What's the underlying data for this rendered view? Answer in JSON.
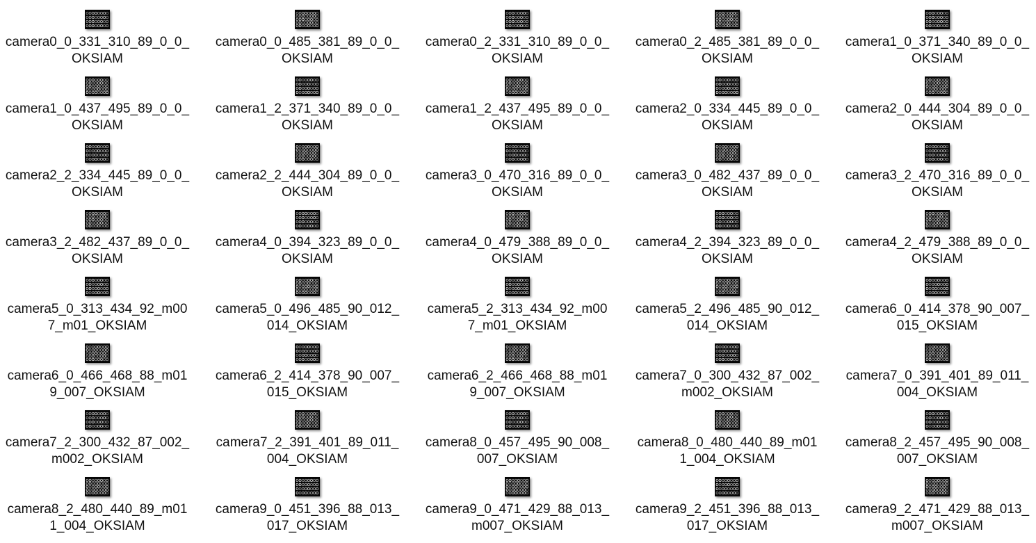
{
  "files": [
    {
      "line1": "camera0_0_331_310_89_0_0_",
      "line2": "OKSIAM",
      "thumbnail_icon": "image-thumbnail-icon"
    },
    {
      "line1": "camera0_0_485_381_89_0_0_",
      "line2": "OKSIAM",
      "thumbnail_icon": "image-thumbnail-icon"
    },
    {
      "line1": "camera0_2_331_310_89_0_0_",
      "line2": "OKSIAM",
      "thumbnail_icon": "image-thumbnail-icon"
    },
    {
      "line1": "camera0_2_485_381_89_0_0_",
      "line2": "OKSIAM",
      "thumbnail_icon": "image-thumbnail-icon"
    },
    {
      "line1": "camera1_0_371_340_89_0_0_",
      "line2": "OKSIAM",
      "thumbnail_icon": "image-thumbnail-icon"
    },
    {
      "line1": "camera1_0_437_495_89_0_0_",
      "line2": "OKSIAM",
      "thumbnail_icon": "image-thumbnail-icon"
    },
    {
      "line1": "camera1_2_371_340_89_0_0_",
      "line2": "OKSIAM",
      "thumbnail_icon": "image-thumbnail-icon"
    },
    {
      "line1": "camera1_2_437_495_89_0_0_",
      "line2": "OKSIAM",
      "thumbnail_icon": "image-thumbnail-icon"
    },
    {
      "line1": "camera2_0_334_445_89_0_0_",
      "line2": "OKSIAM",
      "thumbnail_icon": "image-thumbnail-icon"
    },
    {
      "line1": "camera2_0_444_304_89_0_0_",
      "line2": "OKSIAM",
      "thumbnail_icon": "image-thumbnail-icon"
    },
    {
      "line1": "camera2_2_334_445_89_0_0_",
      "line2": "OKSIAM",
      "thumbnail_icon": "image-thumbnail-icon"
    },
    {
      "line1": "camera2_2_444_304_89_0_0_",
      "line2": "OKSIAM",
      "thumbnail_icon": "image-thumbnail-icon"
    },
    {
      "line1": "camera3_0_470_316_89_0_0_",
      "line2": "OKSIAM",
      "thumbnail_icon": "image-thumbnail-icon"
    },
    {
      "line1": "camera3_0_482_437_89_0_0_",
      "line2": "OKSIAM",
      "thumbnail_icon": "image-thumbnail-icon"
    },
    {
      "line1": "camera3_2_470_316_89_0_0_",
      "line2": "OKSIAM",
      "thumbnail_icon": "image-thumbnail-icon"
    },
    {
      "line1": "camera3_2_482_437_89_0_0_",
      "line2": "OKSIAM",
      "thumbnail_icon": "image-thumbnail-icon"
    },
    {
      "line1": "camera4_0_394_323_89_0_0_",
      "line2": "OKSIAM",
      "thumbnail_icon": "image-thumbnail-icon"
    },
    {
      "line1": "camera4_0_479_388_89_0_0_",
      "line2": "OKSIAM",
      "thumbnail_icon": "image-thumbnail-icon"
    },
    {
      "line1": "camera4_2_394_323_89_0_0_",
      "line2": "OKSIAM",
      "thumbnail_icon": "image-thumbnail-icon"
    },
    {
      "line1": "camera4_2_479_388_89_0_0_",
      "line2": "OKSIAM",
      "thumbnail_icon": "image-thumbnail-icon"
    },
    {
      "line1": "camera5_0_313_434_92_m00",
      "line2": "7_m01_OKSIAM",
      "thumbnail_icon": "image-thumbnail-icon"
    },
    {
      "line1": "camera5_0_496_485_90_012_",
      "line2": "014_OKSIAM",
      "thumbnail_icon": "image-thumbnail-icon"
    },
    {
      "line1": "camera5_2_313_434_92_m00",
      "line2": "7_m01_OKSIAM",
      "thumbnail_icon": "image-thumbnail-icon"
    },
    {
      "line1": "camera5_2_496_485_90_012_",
      "line2": "014_OKSIAM",
      "thumbnail_icon": "image-thumbnail-icon"
    },
    {
      "line1": "camera6_0_414_378_90_007_",
      "line2": "015_OKSIAM",
      "thumbnail_icon": "image-thumbnail-icon"
    },
    {
      "line1": "camera6_0_466_468_88_m01",
      "line2": "9_007_OKSIAM",
      "thumbnail_icon": "image-thumbnail-icon"
    },
    {
      "line1": "camera6_2_414_378_90_007_",
      "line2": "015_OKSIAM",
      "thumbnail_icon": "image-thumbnail-icon"
    },
    {
      "line1": "camera6_2_466_468_88_m01",
      "line2": "9_007_OKSIAM",
      "thumbnail_icon": "image-thumbnail-icon"
    },
    {
      "line1": "camera7_0_300_432_87_002_",
      "line2": "m002_OKSIAM",
      "thumbnail_icon": "image-thumbnail-icon"
    },
    {
      "line1": "camera7_0_391_401_89_011_",
      "line2": "004_OKSIAM",
      "thumbnail_icon": "image-thumbnail-icon"
    },
    {
      "line1": "camera7_2_300_432_87_002_",
      "line2": "m002_OKSIAM",
      "thumbnail_icon": "image-thumbnail-icon"
    },
    {
      "line1": "camera7_2_391_401_89_011_",
      "line2": "004_OKSIAM",
      "thumbnail_icon": "image-thumbnail-icon"
    },
    {
      "line1": "camera8_0_457_495_90_008_",
      "line2": "007_OKSIAM",
      "thumbnail_icon": "image-thumbnail-icon"
    },
    {
      "line1": "camera8_0_480_440_89_m01",
      "line2": "1_004_OKSIAM",
      "thumbnail_icon": "image-thumbnail-icon"
    },
    {
      "line1": "camera8_2_457_495_90_008_",
      "line2": "007_OKSIAM",
      "thumbnail_icon": "image-thumbnail-icon"
    },
    {
      "line1": "camera8_2_480_440_89_m01",
      "line2": "1_004_OKSIAM",
      "thumbnail_icon": "image-thumbnail-icon"
    },
    {
      "line1": "camera9_0_451_396_88_013_",
      "line2": "017_OKSIAM",
      "thumbnail_icon": "image-thumbnail-icon"
    },
    {
      "line1": "camera9_0_471_429_88_013_",
      "line2": "m007_OKSIAM",
      "thumbnail_icon": "image-thumbnail-icon"
    },
    {
      "line1": "camera9_2_451_396_88_013_",
      "line2": "017_OKSIAM",
      "thumbnail_icon": "image-thumbnail-icon"
    },
    {
      "line1": "camera9_2_471_429_88_013_",
      "line2": "m007_OKSIAM",
      "thumbnail_icon": "image-thumbnail-icon"
    }
  ]
}
